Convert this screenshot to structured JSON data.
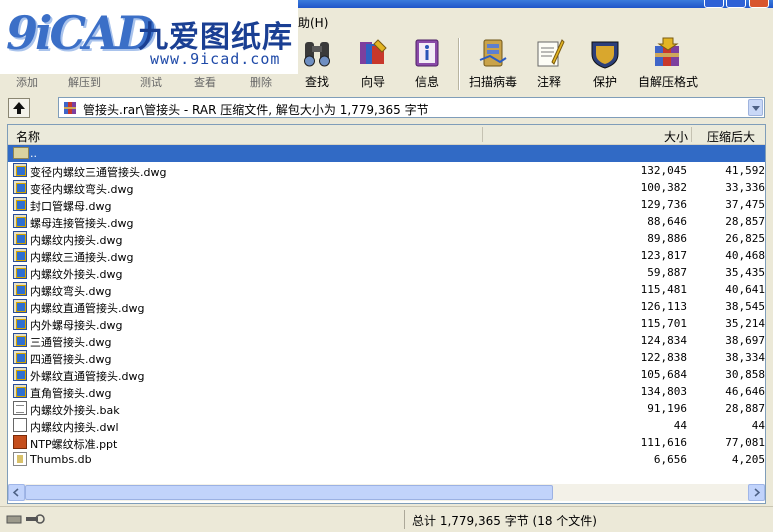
{
  "window": {
    "menu_help_partial": "助(H)"
  },
  "watermark": {
    "glyph": "9iCAD",
    "text": "九爱图纸库",
    "url": "www.9icad.com"
  },
  "toolbar": {
    "items": [
      {
        "label": "查找",
        "icon": "binoculars-icon"
      },
      {
        "label": "向导",
        "icon": "wizard-icon"
      },
      {
        "label": "信息",
        "icon": "info-icon"
      },
      {
        "label": "扫描病毒",
        "icon": "virus-scan-icon"
      },
      {
        "label": "注释",
        "icon": "comment-icon"
      },
      {
        "label": "保护",
        "icon": "shield-icon"
      },
      {
        "label": "自解压格式",
        "icon": "sfx-archive-icon"
      }
    ],
    "partial_labels": [
      "添加",
      "解压到",
      "测试",
      "查看",
      "删除"
    ]
  },
  "address": {
    "path": "管接头.rar\\管接头 - RAR 压缩文件, 解包大小为 1,779,365 字节"
  },
  "columns": {
    "name": "名称",
    "size": "大小",
    "packed": "压缩后大小"
  },
  "files": [
    {
      "name": "..",
      "size": "",
      "packed": "",
      "type": "folder-up",
      "selected": true
    },
    {
      "name": "变径内螺纹三通管接头.dwg",
      "size": "132,045",
      "packed": "41,592",
      "type": "dwg"
    },
    {
      "name": "变径内螺纹弯头.dwg",
      "size": "100,382",
      "packed": "33,336",
      "type": "dwg"
    },
    {
      "name": "封口管螺母.dwg",
      "size": "129,736",
      "packed": "37,475",
      "type": "dwg"
    },
    {
      "name": "螺母连接管接头.dwg",
      "size": "88,646",
      "packed": "28,857",
      "type": "dwg"
    },
    {
      "name": "内螺纹内接头.dwg",
      "size": "89,886",
      "packed": "26,825",
      "type": "dwg"
    },
    {
      "name": "内螺纹三通接头.dwg",
      "size": "123,817",
      "packed": "40,468",
      "type": "dwg"
    },
    {
      "name": "内螺纹外接头.dwg",
      "size": "59,887",
      "packed": "35,435",
      "type": "dwg"
    },
    {
      "name": "内螺纹弯头.dwg",
      "size": "115,481",
      "packed": "40,641",
      "type": "dwg"
    },
    {
      "name": "内螺纹直通管接头.dwg",
      "size": "126,113",
      "packed": "38,545",
      "type": "dwg"
    },
    {
      "name": "内外螺母接头.dwg",
      "size": "115,701",
      "packed": "35,214",
      "type": "dwg"
    },
    {
      "name": "三通管接头.dwg",
      "size": "124,834",
      "packed": "38,697",
      "type": "dwg"
    },
    {
      "name": "四通管接头.dwg",
      "size": "122,838",
      "packed": "38,334",
      "type": "dwg"
    },
    {
      "name": "外螺纹直通管接头.dwg",
      "size": "105,684",
      "packed": "30,858",
      "type": "dwg"
    },
    {
      "name": "直角管接头.dwg",
      "size": "134,803",
      "packed": "46,646",
      "type": "dwg"
    },
    {
      "name": "内螺纹外接头.bak",
      "size": "91,196",
      "packed": "28,887",
      "type": "bak"
    },
    {
      "name": "内螺纹内接头.dwl",
      "size": "44",
      "packed": "44",
      "type": "dwl"
    },
    {
      "name": "NTP螺纹标准.ppt",
      "size": "111,616",
      "packed": "77,081",
      "type": "ppt"
    },
    {
      "name": "Thumbs.db",
      "size": "6,656",
      "packed": "4,205",
      "type": "db"
    }
  ],
  "status": {
    "total": "总计 1,779,365 字节 (18 个文件)"
  }
}
